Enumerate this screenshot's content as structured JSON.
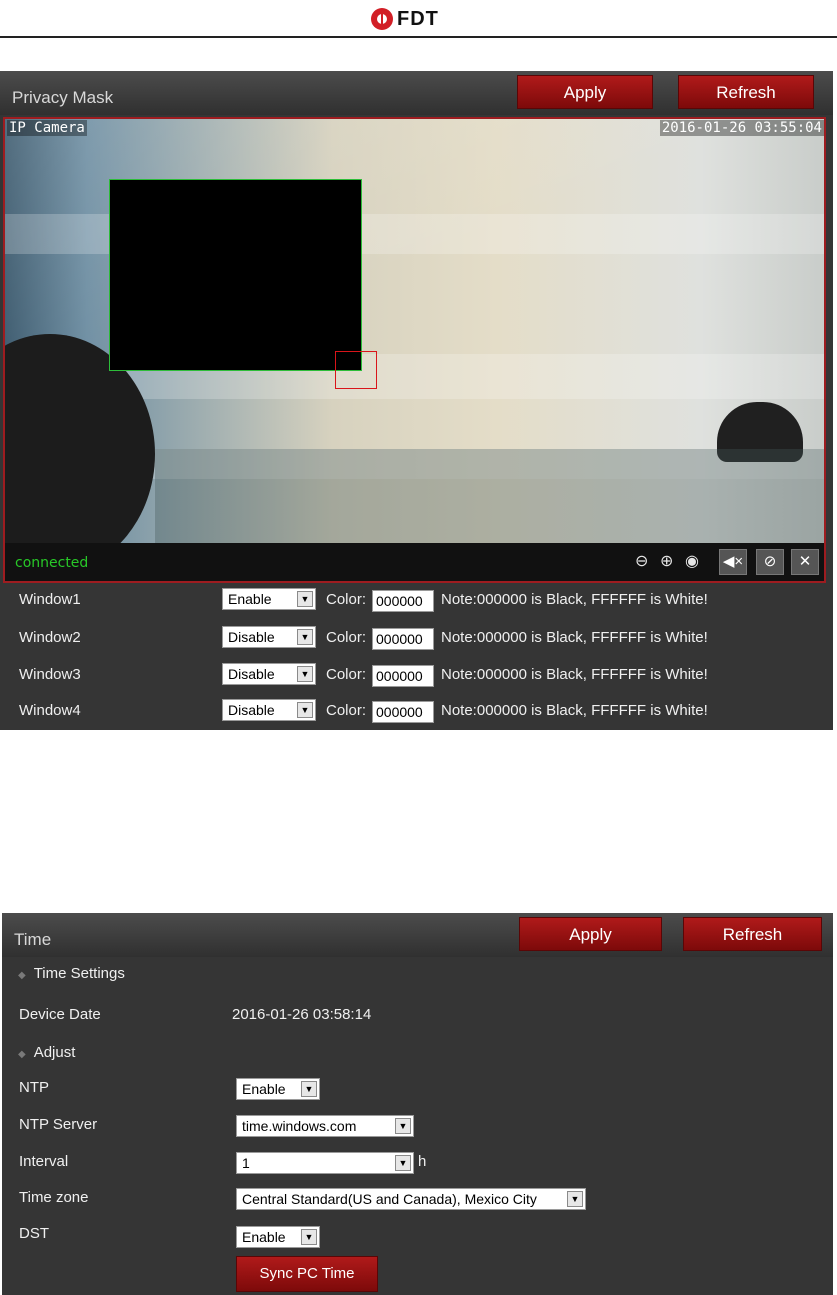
{
  "header": {
    "brand": "FDT"
  },
  "privacy_mask": {
    "title": "Privacy Mask",
    "apply_label": "Apply",
    "refresh_label": "Refresh",
    "video": {
      "camera_label": "IP Camera",
      "timestamp": "2016-01-26 03:55:04",
      "status": "connected",
      "mask_color": "#000000",
      "icons": [
        "zoom-out-icon",
        "zoom-in-icon",
        "record-icon",
        "mute-speaker-icon",
        "mute-mic-icon",
        "settings-tools-icon"
      ]
    },
    "color_label": "Color:",
    "note": "Note:000000 is Black, FFFFFF is White!",
    "windows": [
      {
        "label": "Window1",
        "state": "Enable",
        "color": "000000"
      },
      {
        "label": "Window2",
        "state": "Disable",
        "color": "000000"
      },
      {
        "label": "Window3",
        "state": "Disable",
        "color": "000000"
      },
      {
        "label": "Window4",
        "state": "Disable",
        "color": "000000"
      }
    ]
  },
  "time": {
    "title": "Time",
    "apply_label": "Apply",
    "refresh_label": "Refresh",
    "section_settings": "Time Settings",
    "device_date_label": "Device Date",
    "device_date_value": "2016-01-26 03:58:14",
    "section_adjust": "Adjust",
    "ntp_label": "NTP",
    "ntp_value": "Enable",
    "ntp_server_label": "NTP Server",
    "ntp_server_value": "time.windows.com",
    "interval_label": "Interval",
    "interval_value": "1",
    "interval_unit": "h",
    "timezone_label": "Time zone",
    "timezone_value": "Central Standard(US and Canada), Mexico City",
    "dst_label": "DST",
    "dst_value": "Enable",
    "sync_label": "Sync PC Time"
  },
  "colors": {
    "accent": "#9e1c20",
    "panel": "#353535",
    "status_green": "#28c828",
    "mask_border": "#2dbd39"
  }
}
